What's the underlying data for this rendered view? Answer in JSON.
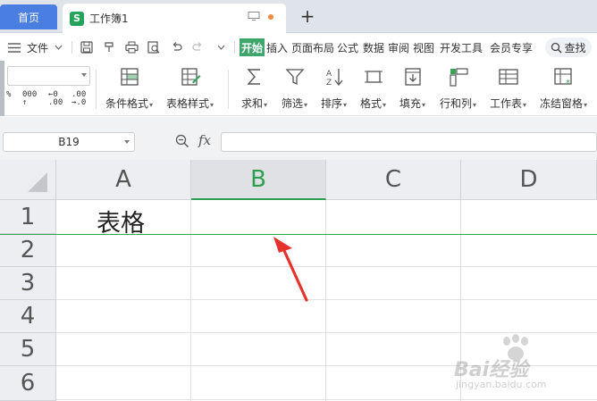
{
  "tabs": {
    "home_label": "首页",
    "doc_logo": "S",
    "doc_name": "工作簿1"
  },
  "menu": {
    "file_label": "文件",
    "items": [
      "开始",
      "插入",
      "页面布局",
      "公式",
      "数据",
      "审阅",
      "视图",
      "开发工具",
      "会员专享"
    ],
    "search_label": "查找"
  },
  "ribbon": {
    "numfmt_top": [
      "000",
      "←0",
      ".00"
    ],
    "numfmt_bottom": [
      "↑",
      ".00",
      "→.0"
    ],
    "buttons": [
      {
        "label": "条件格式",
        "icon": "conditional-format-icon"
      },
      {
        "label": "表格样式",
        "icon": "table-style-icon"
      },
      {
        "label": "求和",
        "icon": "sum-icon"
      },
      {
        "label": "筛选",
        "icon": "filter-icon"
      },
      {
        "label": "排序",
        "icon": "sort-icon"
      },
      {
        "label": "格式",
        "icon": "format-icon"
      },
      {
        "label": "填充",
        "icon": "fill-icon"
      },
      {
        "label": "行和列",
        "icon": "row-col-icon"
      },
      {
        "label": "工作表",
        "icon": "worksheet-icon"
      },
      {
        "label": "冻结窗格",
        "icon": "freeze-pane-icon"
      }
    ]
  },
  "formula_bar": {
    "name_box": "B19",
    "fx_label": "fx",
    "formula": ""
  },
  "grid": {
    "columns": [
      "A",
      "B",
      "C",
      "D"
    ],
    "rows": [
      "1",
      "2",
      "3",
      "4",
      "5",
      "6"
    ],
    "active_column": "B",
    "cell_A1": "表格"
  },
  "watermark": {
    "brand": "Bai经验",
    "url": "jingyan.baidu.com"
  },
  "colors": {
    "accent_green": "#2e9e4f",
    "home_tab_blue": "#4a7ee0",
    "arrow_red": "#e5322d"
  }
}
